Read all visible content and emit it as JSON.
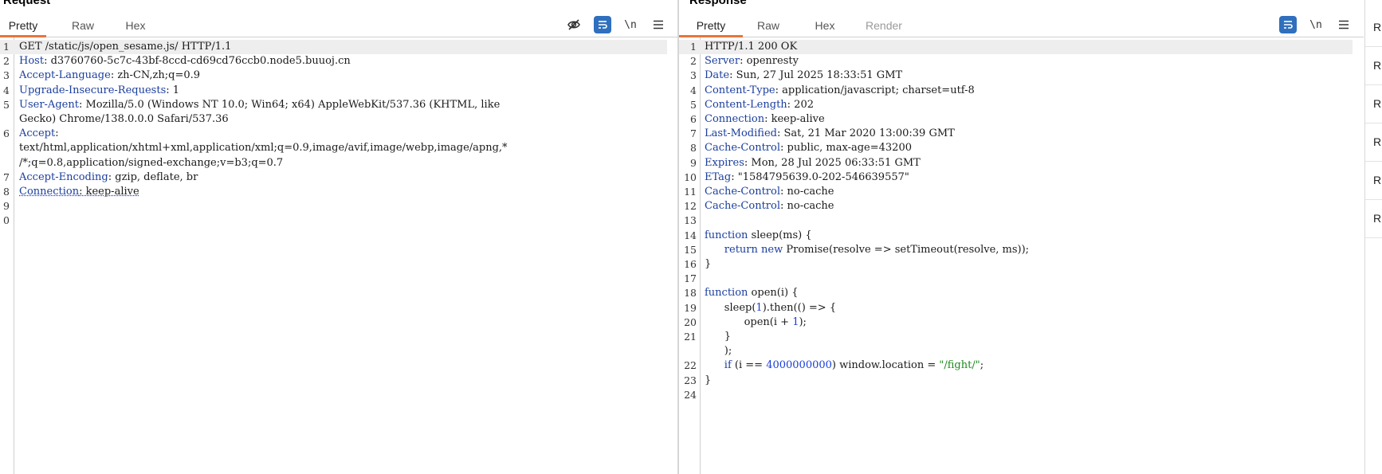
{
  "request": {
    "title": "Request",
    "tabs": [
      "Pretty",
      "Raw",
      "Hex"
    ],
    "active_tab": "Pretty",
    "toolbar": {
      "newline_label": "\\n"
    },
    "lines": [
      {
        "n": "1",
        "parts": [
          {
            "t": "GET /static/js/open_sesame.js/ HTTP/1.1"
          }
        ]
      },
      {
        "n": "2",
        "parts": [
          {
            "t": "Host",
            "c": "k"
          },
          {
            "t": ": d3760760-5c7c-43bf-8ccd-cd69cd76ccb0.node5.buuoj.cn"
          }
        ]
      },
      {
        "n": "3",
        "parts": [
          {
            "t": "Accept-Language",
            "c": "k"
          },
          {
            "t": ": zh-CN,zh;q=0.9"
          }
        ]
      },
      {
        "n": "4",
        "parts": [
          {
            "t": "Upgrade-Insecure-Requests",
            "c": "k"
          },
          {
            "t": ": 1"
          }
        ]
      },
      {
        "n": "5",
        "parts": [
          {
            "t": "User-Agent",
            "c": "k"
          },
          {
            "t": ": Mozilla/5.0 (Windows NT 10.0; Win64; x64) AppleWebKit/537.36 (KHTML, like"
          }
        ]
      },
      {
        "n": "",
        "parts": [
          {
            "t": "Gecko) Chrome/138.0.0.0 Safari/537.36"
          }
        ]
      },
      {
        "n": "6",
        "parts": [
          {
            "t": "Accept",
            "c": "k"
          },
          {
            "t": ":"
          }
        ]
      },
      {
        "n": "",
        "parts": [
          {
            "t": "text/html,application/xhtml+xml,application/xml;q=0.9,image/avif,image/webp,image/apng,*"
          }
        ]
      },
      {
        "n": "",
        "parts": [
          {
            "t": "/*;q=0.8,application/signed-exchange;v=b3;q=0.7"
          }
        ]
      },
      {
        "n": "7",
        "parts": [
          {
            "t": "Accept-Encoding",
            "c": "k"
          },
          {
            "t": ": gzip, deflate, br"
          }
        ]
      },
      {
        "n": "8",
        "parts": [
          {
            "t": "Connection",
            "c": "k ul"
          },
          {
            "t": ": keep-alive",
            "c": "ul"
          }
        ]
      },
      {
        "n": "9",
        "parts": []
      },
      {
        "n": "0",
        "parts": []
      }
    ]
  },
  "response": {
    "title": "Response",
    "tabs": [
      "Pretty",
      "Raw",
      "Hex",
      "Render"
    ],
    "active_tab": "Pretty",
    "toolbar": {
      "newline_label": "\\n"
    },
    "lines": [
      {
        "n": "1",
        "parts": [
          {
            "t": "HTTP/1.1 200 OK"
          }
        ]
      },
      {
        "n": "2",
        "parts": [
          {
            "t": "Server",
            "c": "k"
          },
          {
            "t": ": openresty"
          }
        ]
      },
      {
        "n": "3",
        "parts": [
          {
            "t": "Date",
            "c": "k"
          },
          {
            "t": ": Sun, 27 Jul 2025 18:33:51 GMT"
          }
        ]
      },
      {
        "n": "4",
        "parts": [
          {
            "t": "Content-Type",
            "c": "k"
          },
          {
            "t": ": application/javascript; charset=utf-8"
          }
        ]
      },
      {
        "n": "5",
        "parts": [
          {
            "t": "Content-Length",
            "c": "k"
          },
          {
            "t": ": 202"
          }
        ]
      },
      {
        "n": "6",
        "parts": [
          {
            "t": "Connection",
            "c": "k"
          },
          {
            "t": ": keep-alive"
          }
        ]
      },
      {
        "n": "7",
        "parts": [
          {
            "t": "Last-Modified",
            "c": "k"
          },
          {
            "t": ": Sat, 21 Mar 2020 13:00:39 GMT"
          }
        ]
      },
      {
        "n": "8",
        "parts": [
          {
            "t": "Cache-Control",
            "c": "k"
          },
          {
            "t": ": public, max-age=43200"
          }
        ]
      },
      {
        "n": "9",
        "parts": [
          {
            "t": "Expires",
            "c": "k"
          },
          {
            "t": ": Mon, 28 Jul 2025 06:33:51 GMT"
          }
        ]
      },
      {
        "n": "10",
        "parts": [
          {
            "t": "ETag",
            "c": "k"
          },
          {
            "t": ": \"1584795639.0-202-546639557\""
          }
        ]
      },
      {
        "n": "11",
        "parts": [
          {
            "t": "Cache-Control",
            "c": "k"
          },
          {
            "t": ": no-cache"
          }
        ]
      },
      {
        "n": "12",
        "parts": [
          {
            "t": "Cache-Control",
            "c": "k"
          },
          {
            "t": ": no-cache"
          }
        ]
      },
      {
        "n": "13",
        "parts": []
      },
      {
        "n": "14",
        "parts": [
          {
            "t": "function",
            "c": "kw"
          },
          {
            "t": " sleep(ms) {"
          }
        ]
      },
      {
        "n": "15",
        "parts": [
          {
            "t": "      "
          },
          {
            "t": "return",
            "c": "kw"
          },
          {
            "t": " "
          },
          {
            "t": "new",
            "c": "kw"
          },
          {
            "t": " Promise(resolve => setTimeout(resolve, ms));"
          }
        ]
      },
      {
        "n": "16",
        "parts": [
          {
            "t": "}"
          }
        ]
      },
      {
        "n": "17",
        "parts": []
      },
      {
        "n": "18",
        "parts": [
          {
            "t": "function",
            "c": "kw"
          },
          {
            "t": " open(i) {"
          }
        ]
      },
      {
        "n": "19",
        "parts": [
          {
            "t": "      sleep("
          },
          {
            "t": "1",
            "c": "num"
          },
          {
            "t": ").then(() => {"
          }
        ]
      },
      {
        "n": "20",
        "parts": [
          {
            "t": "            open(i + "
          },
          {
            "t": "1",
            "c": "num"
          },
          {
            "t": ");"
          }
        ]
      },
      {
        "n": "21",
        "parts": [
          {
            "t": "      }"
          }
        ]
      },
      {
        "n": "",
        "parts": [
          {
            "t": "      );"
          }
        ]
      },
      {
        "n": "22",
        "parts": [
          {
            "t": "      "
          },
          {
            "t": "if",
            "c": "kw"
          },
          {
            "t": " (i == "
          },
          {
            "t": "4000000000",
            "c": "num"
          },
          {
            "t": ") window.location = "
          },
          {
            "t": "\"/fight/\"",
            "c": "str"
          },
          {
            "t": ";"
          }
        ]
      },
      {
        "n": "23",
        "parts": [
          {
            "t": "}"
          }
        ]
      },
      {
        "n": "24",
        "parts": []
      }
    ]
  },
  "side_panel": {
    "items": [
      "R",
      "R",
      "R",
      "R",
      "R",
      "R"
    ]
  }
}
